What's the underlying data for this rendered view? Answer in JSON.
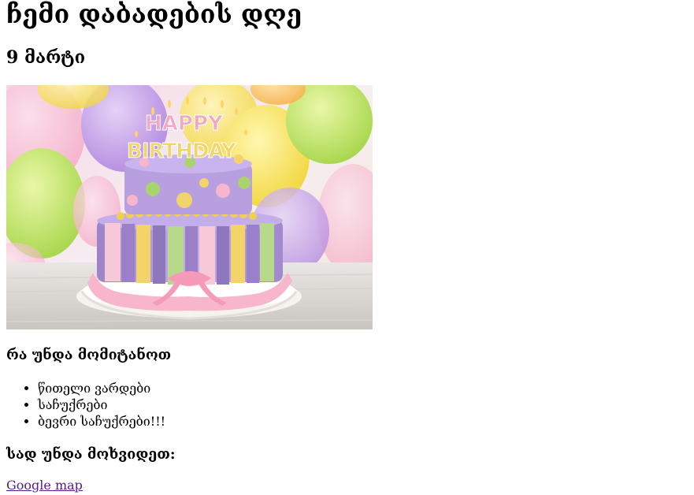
{
  "page": {
    "title": "ჩემი დაბადების დღე",
    "date": "9 მარტი"
  },
  "image": {
    "description_alt": "HAPPY BIRTHDAY",
    "candle_top": "HAPPY",
    "candle_bottom": "BIRTHDAY"
  },
  "bring_section": {
    "heading": "რა უნდა მომიტანოთ",
    "items": [
      "წითელი ვარდები",
      "საჩუქრები",
      "ბევრი საჩუქრები!!!"
    ]
  },
  "where_section": {
    "heading": "სად უნდა მოხვიდეთ:",
    "link_text": "Google map"
  },
  "colors": {
    "link_visited": "#551a8b",
    "text": "#000000",
    "background": "#ffffff"
  }
}
